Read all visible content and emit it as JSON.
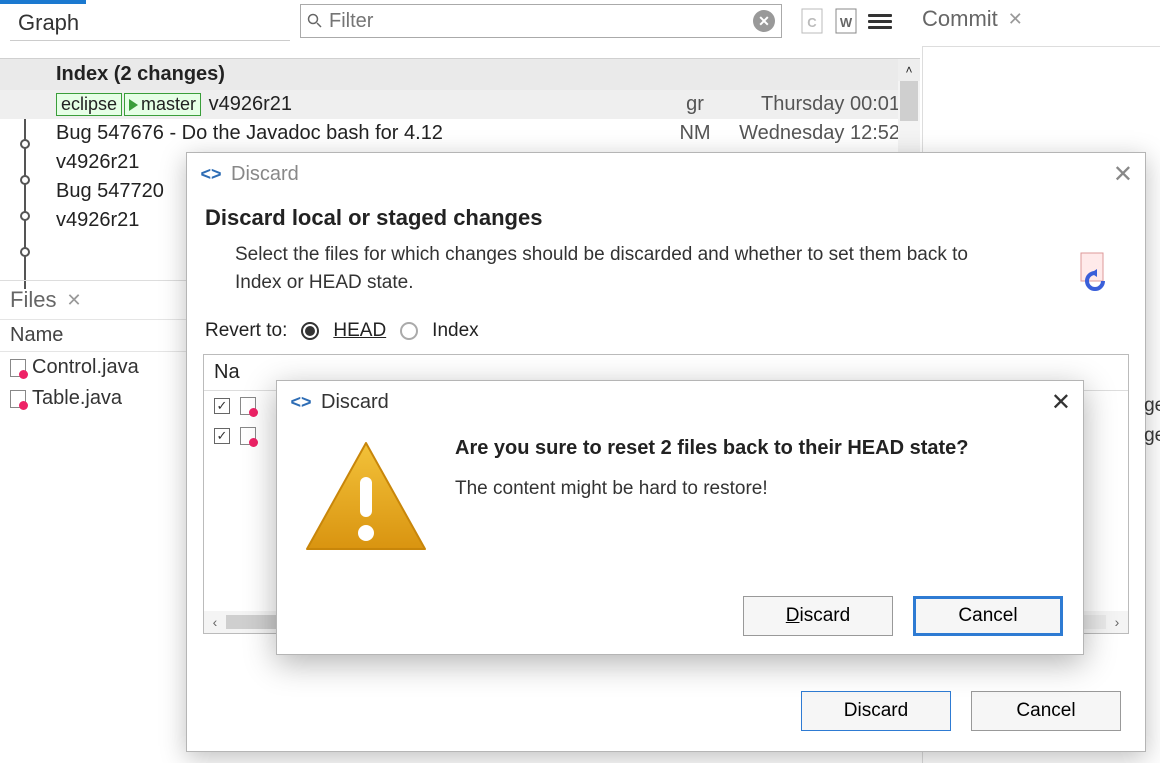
{
  "topbar": {
    "graph_tab": "Graph",
    "filter_placeholder": "Filter",
    "commit_tab": "Commit"
  },
  "graph": {
    "index_row": "Index (2 changes)",
    "commits": [
      {
        "tags": [
          "eclipse",
          "master"
        ],
        "msg": "v4926r21",
        "author": "gr",
        "time": "Thursday 00:01"
      },
      {
        "tags": [],
        "msg": "Bug 547676 - Do the Javadoc bash for 4.12",
        "author": "NM",
        "time": "Wednesday 12:52"
      },
      {
        "tags": [],
        "msg": "v4926r21",
        "author": "",
        "time": ""
      },
      {
        "tags": [],
        "msg": "Bug 547720",
        "author": "",
        "time": ""
      },
      {
        "tags": [],
        "msg": "v4926r21",
        "author": "",
        "time": ""
      }
    ]
  },
  "files_panel": {
    "tab": "Files",
    "name_hdr": "Name",
    "files": [
      "Control.java",
      "Table.java"
    ]
  },
  "discard_dialog": {
    "title": "Discard",
    "heading": "Discard local or staged changes",
    "desc": "Select the files for which changes should be discarded and whether to set them back to Index or HEAD state.",
    "revert_label": "Revert to:",
    "radio_head": "HEAD",
    "radio_index": "Index",
    "list_name_hdr": "Na",
    "list_rows": [
      {
        "checked": true,
        "path_tail": "gets"
      },
      {
        "checked": true,
        "path_tail": "gets"
      }
    ],
    "btn_discard": "Discard",
    "btn_cancel": "Cancel"
  },
  "confirm_dialog": {
    "title": "Discard",
    "heading": "Are you sure to reset 2 files back to their HEAD state?",
    "body": "The content might be hard to restore!",
    "btn_discard": "Discard",
    "btn_cancel": "Cancel"
  }
}
